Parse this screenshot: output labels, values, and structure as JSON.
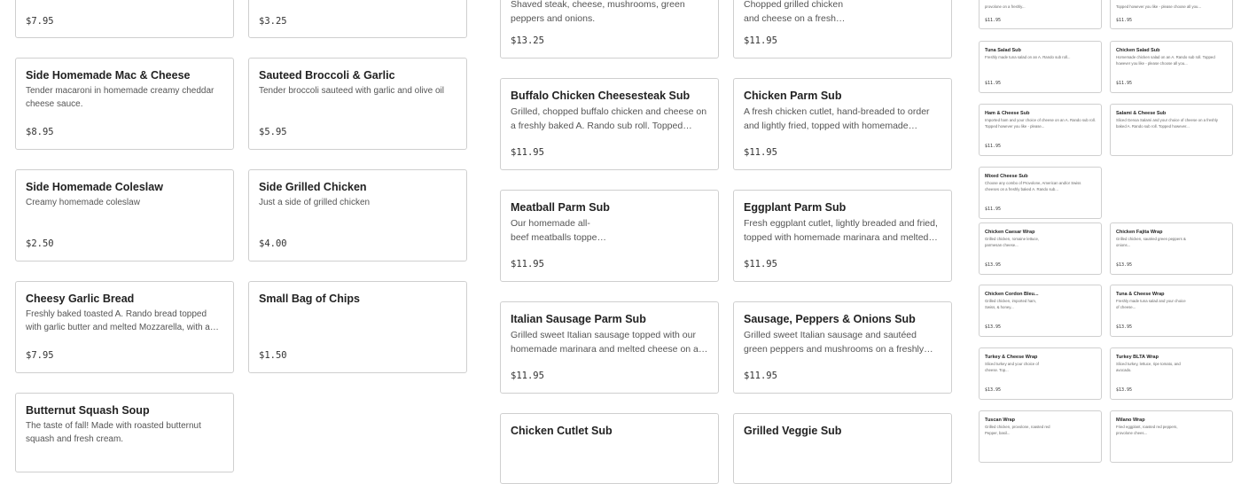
{
  "col1": [
    {
      "price": "$7.95"
    },
    {
      "title": "Side Homemade Mac & Cheese",
      "desc": "Tender macaroni in homemade creamy cheddar cheese sauce.",
      "price": "$8.95"
    },
    {
      "title": "Side Homemade Coleslaw",
      "desc": "Creamy homemade coleslaw",
      "price": "$2.50"
    },
    {
      "title": "Cheesy Garlic Bread",
      "desc": "Freshly baked toasted A. Rando bread topped with garlic butter and melted Mozzarella, with a side of marinara.",
      "price": "$7.95"
    },
    {
      "title": "Butternut Squash Soup",
      "desc": "The taste of fall! Made with roasted butternut squash and fresh cream."
    }
  ],
  "col2": [
    {
      "price": "$3.25"
    },
    {
      "title": "Sauteed Broccoli & Garlic",
      "desc": "Tender broccoli sauteed with garlic and olive oil",
      "price": "$5.95"
    },
    {
      "title": "Side Grilled Chicken",
      "desc": "Just a side of grilled chicken",
      "price": "$4.00"
    },
    {
      "title": "Small Bag of Chips",
      "price": "$1.50"
    }
  ],
  "col3": [
    {
      "desc": "Shaved steak, cheese, mushrooms, green peppers and onions.",
      "price": "$13.25"
    },
    {
      "title": "Buffalo Chicken Cheesesteak Sub",
      "desc": "Grilled, chopped buffalo chicken and cheese on a freshly baked A. Rando sub roll. Topped however you like.",
      "price": "$11.95"
    },
    {
      "title": "Meatball Parm Sub",
      "desc": "Our homemade all-beef meatballs topped with marinara.",
      "price": "$11.95"
    },
    {
      "title": "Italian Sausage Parm Sub",
      "desc": "Grilled sweet Italian sausage topped with our homemade marinara and melted cheese on a freshly baked roll.",
      "price": "$11.95"
    },
    {
      "title": "Chicken Cutlet Sub"
    }
  ],
  "col4": [
    {
      "desc": "Chopped grilled chicken and cheese on a freshly baked roll.",
      "price": "$11.95"
    },
    {
      "title": "Chicken Parm Sub",
      "desc": "A fresh chicken cutlet, hand-breaded to order and lightly fried, topped with homemade marinara and cheese.",
      "price": "$11.95"
    },
    {
      "title": "Eggplant Parm Sub",
      "desc": "Fresh eggplant cutlet, lightly breaded and fried, topped with homemade marinara and melted cheese.",
      "price": "$11.95"
    },
    {
      "title": "Sausage, Peppers & Onions Sub",
      "desc": "Grilled sweet Italian sausage and sautéed green peppers and mushrooms on a freshly baked A. Rando roll.",
      "price": "$11.95"
    },
    {
      "title": "Grilled Veggie Sub"
    }
  ],
  "mini_left": [
    {
      "desc": "provolone on a freshly...",
      "price": "$11.95"
    },
    {
      "title": "Tuna Salad Sub",
      "desc": "Freshly made tuna salad on an A. Rando sub roll...",
      "price": "$11.95"
    },
    {
      "title": "Ham & Cheese Sub",
      "desc": "Imported ham and your choice of cheese on an A. Rando sub roll. Topped however you like - please...",
      "price": "$11.95"
    },
    {
      "title": "Mixed Cheese Sub",
      "desc": "Choose any combo of Provolone, American and/or Swiss cheeses on a freshly baked A. Rando sub...",
      "price": "$11.95"
    },
    {
      "title": "Chicken Caesar Wrap",
      "desc": "Grilled chicken, romaine lettuce, parmesan cheese...",
      "price": "$13.95"
    },
    {
      "title": "Chicken Cordon Bleu...",
      "desc": "Grilled chicken, imported ham, Swiss, & honey...",
      "price": "$13.95"
    },
    {
      "title": "Turkey & Cheese Wrap",
      "desc": "Sliced turkey and your choice of cheese. Top...",
      "price": "$13.95"
    },
    {
      "title": "Tuscan Wrap",
      "desc": "Grilled chicken, provolone, roasted red Pepper, basil..."
    }
  ],
  "mini_right": [
    {
      "desc": "Topped however you like - please choose all you...",
      "price": "$11.95"
    },
    {
      "title": "Chicken Salad Sub",
      "desc": "Homemade chicken salad on an A. Rando sub roll. Topped however you like - please choose all you...",
      "price": "$11.95"
    },
    {
      "title": "Salami & Cheese Sub",
      "desc": "Sliced Genoa Salami and your choice of cheese on a freshly baked A. Rando sub roll. Topped however...",
      "price": "$11.95"
    },
    {
      "title": "Chicken Fajita Wrap",
      "desc": "Grilled chicken, sautéed green peppers & onions...",
      "price": "$13.95"
    },
    {
      "title": "Tuna & Cheese Wrap",
      "desc": "Freshly made tuna salad and your choice of cheese...",
      "price": "$13.95"
    },
    {
      "title": "Turkey BLTA Wrap",
      "desc": "Sliced turkey, lettuce, ripe tomato, and avocado.",
      "price": "$13.95"
    },
    {
      "title": "Milano Wrap",
      "desc": "Fried eggplant, roasted red peppers, provolone chees..."
    }
  ]
}
